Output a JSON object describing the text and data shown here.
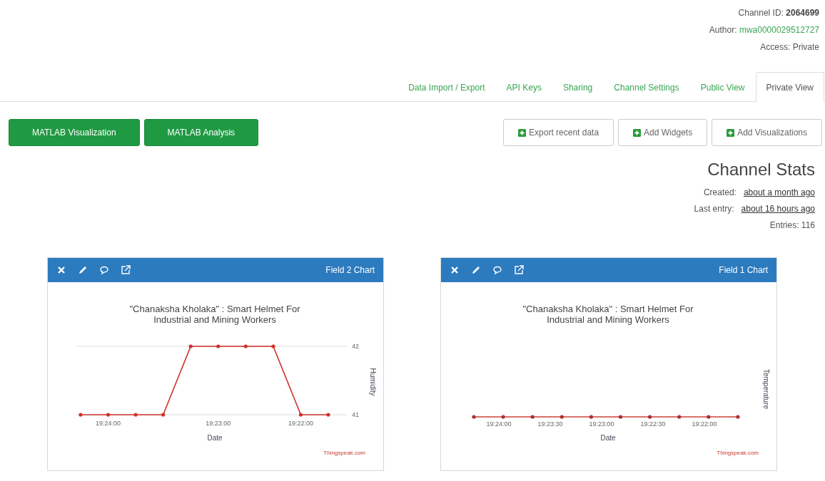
{
  "channel_info": {
    "channel_id_label": "Channel ID:",
    "channel_id": "2064699",
    "author_label": "Author:",
    "author": "mwa0000029512727",
    "access": "Access: Private"
  },
  "tabs": [
    {
      "label": "Data Import / Export",
      "selected": false
    },
    {
      "label": "API Keys",
      "selected": false
    },
    {
      "label": "Sharing",
      "selected": false
    },
    {
      "label": "Channel Settings",
      "selected": false
    },
    {
      "label": "Public View",
      "selected": false
    },
    {
      "label": "Private View",
      "selected": true
    }
  ],
  "toolbar": {
    "left_buttons": [
      "MATLAB Visualization",
      "MATLAB Analysis"
    ],
    "right_buttons": [
      "Export recent data",
      "Add Widgets",
      "Add Visualizations"
    ]
  },
  "channel_stats": {
    "title": "Channel Stats",
    "created_label": "Created:",
    "created": "about a month ago",
    "last_entry_label": "Last entry:",
    "last_entry": "about 16 hours ago",
    "entries": "Entries: 116"
  },
  "charts": [
    {
      "header": "Field 2 Chart",
      "credit": "Thingspeak.com",
      "chart_data": {
        "type": "line",
        "title": "\"Chanaksha Kholaka\" : Smart Helmet For Industrial and Mining Workers",
        "xlabel": "Date",
        "ylabel": "Humidity",
        "ylim": [
          41,
          42
        ],
        "yticks": [
          41,
          42
        ],
        "categories": [
          null,
          "19:24:00",
          null,
          null,
          null,
          "19:23:00",
          null,
          null,
          "19:22:00",
          null
        ],
        "series": [
          {
            "color": "#d0302c",
            "values": [
              41,
              41,
              41,
              41,
              42,
              42,
              42,
              42,
              41,
              41
            ]
          }
        ]
      }
    },
    {
      "header": "Field 1 Chart",
      "title": "\"Chanaksha Kholaka\" : Smart Helmet For Industrial and Mining Workers",
      "xlabel": "Date",
      "ylabel": "Temperature",
      "xtick_labels": [
        "19:24:00",
        "19:23:30",
        "19:23:00",
        "19:22:30",
        "19:22:00"
      ],
      "credit": "Thingspeak.com"
    }
  ]
}
